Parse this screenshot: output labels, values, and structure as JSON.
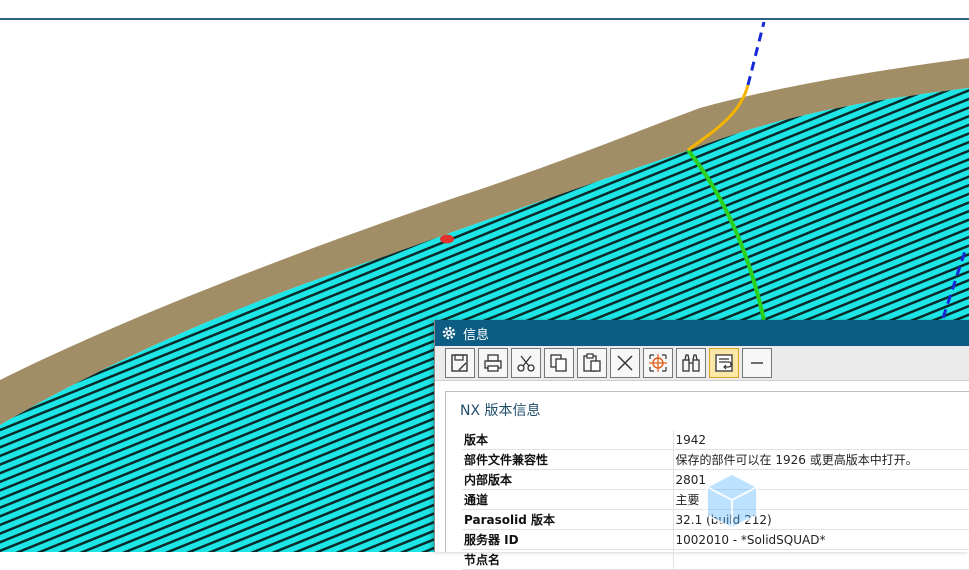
{
  "window": {
    "title": "信息",
    "icon": "gear-icon"
  },
  "toolbar": {
    "buttons": [
      {
        "name": "save-icon"
      },
      {
        "name": "print-icon"
      },
      {
        "name": "cut-icon"
      },
      {
        "name": "copy-icon"
      },
      {
        "name": "paste-icon"
      },
      {
        "name": "delete-icon"
      },
      {
        "name": "crosshair-icon"
      },
      {
        "name": "binoculars-icon"
      },
      {
        "name": "wrap-text-icon",
        "active": true
      },
      {
        "name": "minimize-icon"
      }
    ]
  },
  "info": {
    "section_title": "NX 版本信息",
    "rows": [
      {
        "key": "版本",
        "value": "1942"
      },
      {
        "key": "部件文件兼容性",
        "value": "保存的部件可以在 1926 或更高版本中打开。"
      },
      {
        "key": "内部版本",
        "value": "2801"
      },
      {
        "key": "通道",
        "value": "主要"
      },
      {
        "key": "Parasolid 版本",
        "value": "32.1 (build 212)"
      },
      {
        "key": "服务器 ID",
        "value": "1002010 - *SolidSQUAD*"
      },
      {
        "key": "节点名",
        "value": ""
      }
    ]
  },
  "colors": {
    "accent": "#0d5c83",
    "surface": "#00e0e0",
    "stock": "#a18e66",
    "curve_green": "#2ad11e",
    "curve_yellow": "#f4b400",
    "curve_blue": "#1428d6",
    "marker_red": "#e3322b"
  }
}
